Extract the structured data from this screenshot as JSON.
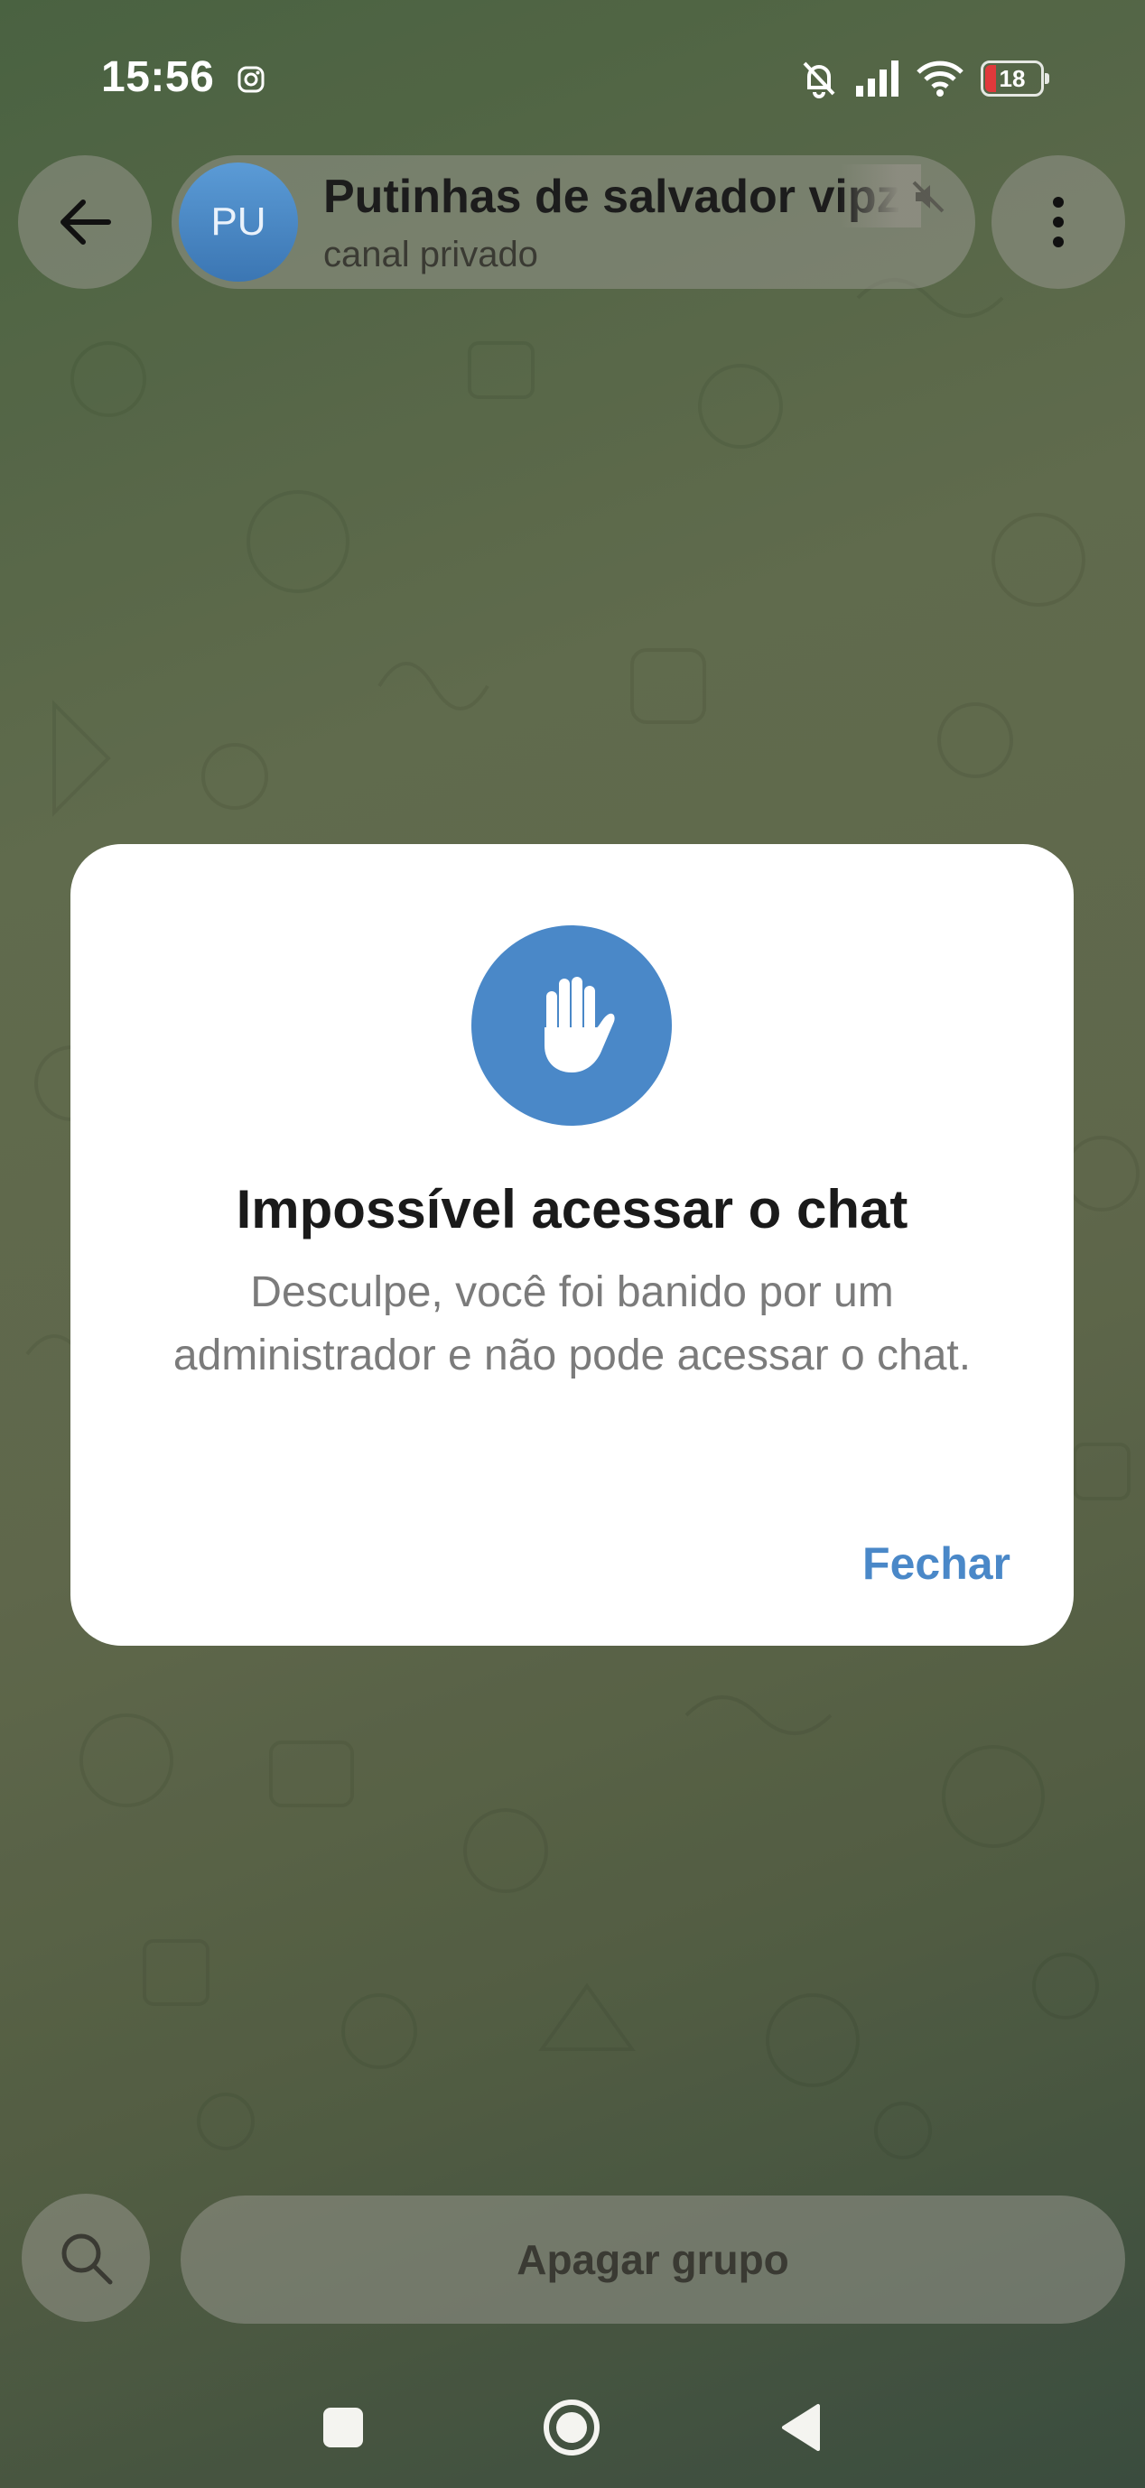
{
  "status_bar": {
    "time": "15:56",
    "battery_level": "18",
    "icons": [
      "instagram-icon",
      "bell-off-icon",
      "signal-icon",
      "wifi-icon",
      "battery-icon"
    ]
  },
  "header": {
    "avatar_initials": "PU",
    "chat_title": "Putinhas de salvador vipz",
    "chat_subtitle": "canal privado",
    "icons": [
      "back-arrow-icon",
      "mute-icon",
      "more-vertical-icon"
    ]
  },
  "dialog": {
    "icon": "hand-stop-icon",
    "title": "Impossível acessar o chat",
    "message": "Desculpe, você foi banido por um administrador e não pode acessar o chat.",
    "close_label": "Fechar"
  },
  "bottom_bar": {
    "search_icon": "search-icon",
    "action_label": "Apagar grupo"
  },
  "nav_bar": {
    "items": [
      "recents-square-icon",
      "home-circle-icon",
      "back-triangle-icon"
    ]
  },
  "colors": {
    "accent": "#4a88c8",
    "avatar": "#4a88c8",
    "battery_low": "#e0393b",
    "dialog_bg": "#ffffff"
  }
}
